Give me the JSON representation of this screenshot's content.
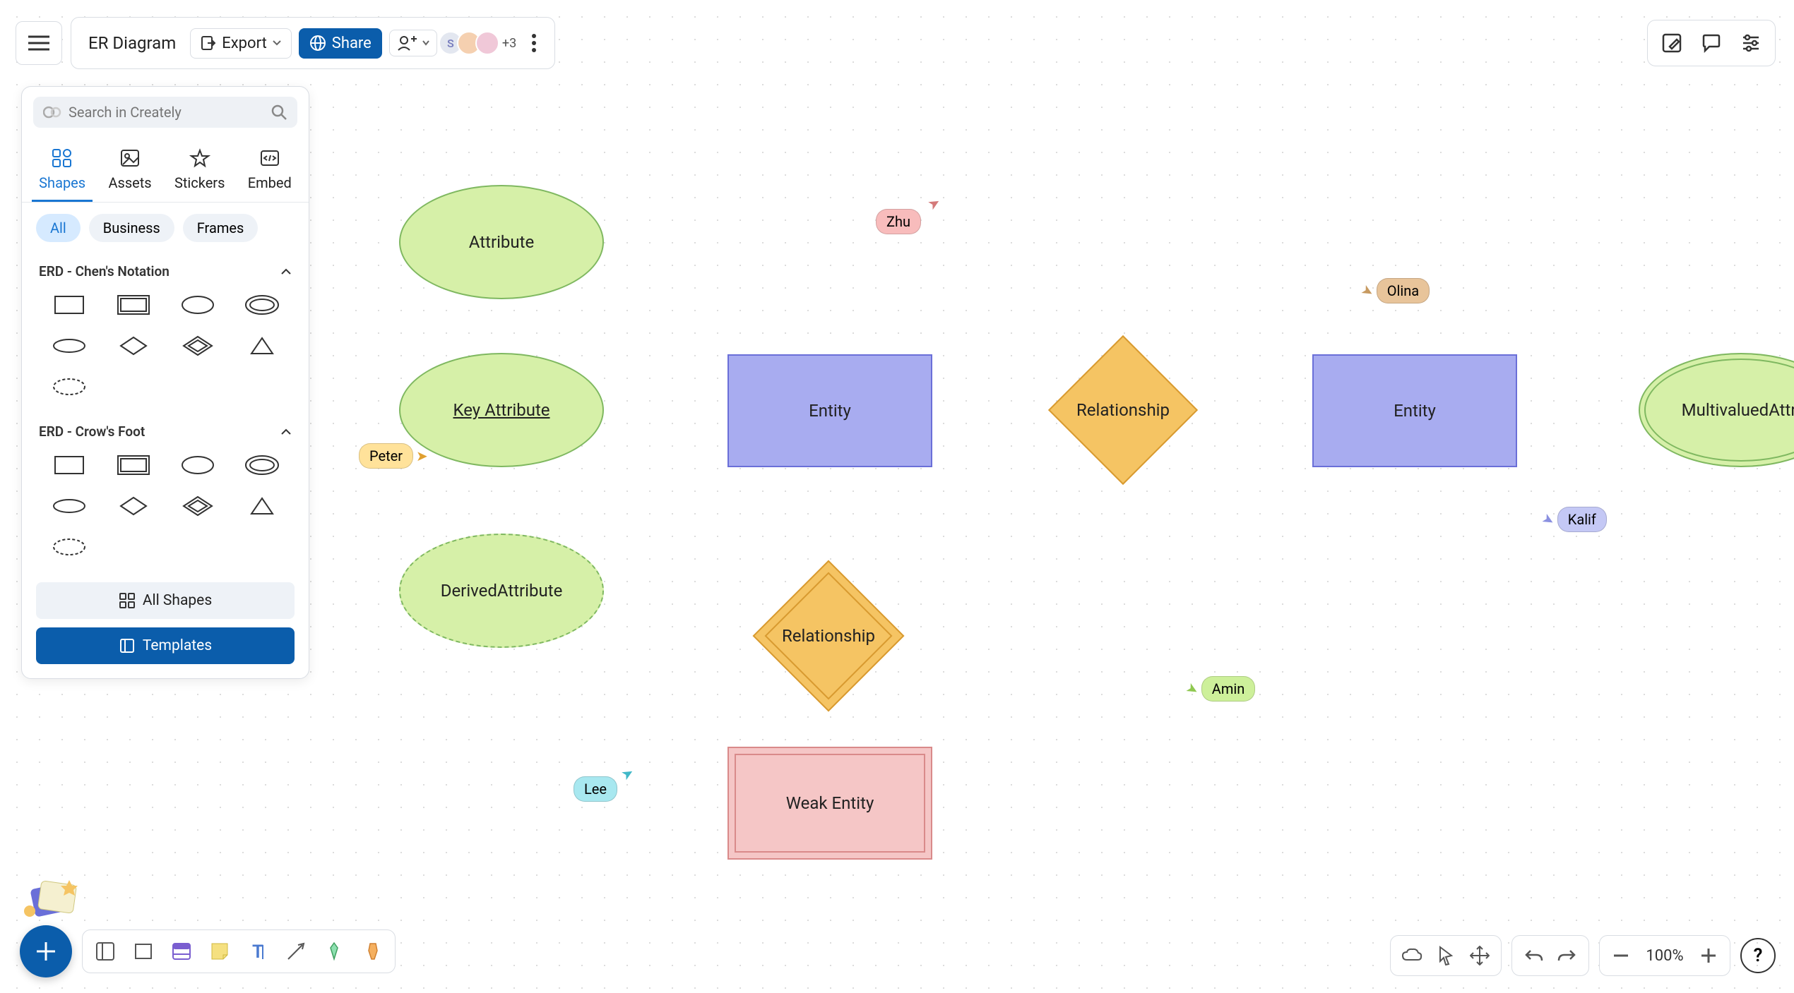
{
  "doc_title": "ER Diagram",
  "toolbar": {
    "export_label": "Export",
    "share_label": "Share",
    "avatar_letter": "S",
    "more_collaborators": "+3"
  },
  "search": {
    "placeholder": "Search in Creately"
  },
  "tabs": {
    "shapes": "Shapes",
    "assets": "Assets",
    "stickers": "Stickers",
    "embed": "Embed"
  },
  "filters": {
    "all": "All",
    "business": "Business",
    "frames": "Frames"
  },
  "sections": {
    "chen": "ERD - Chen's Notation",
    "crow": "ERD - Crow's Foot"
  },
  "panel_footer": {
    "all_shapes": "All Shapes",
    "templates": "Templates"
  },
  "zoom": "100%",
  "shapes": {
    "attribute": "Attribute",
    "key_attribute": "Key Attribute",
    "derived_attribute": "DerivedAttribute",
    "entity1": "Entity",
    "entity2": "Entity",
    "relationship1": "Relationship",
    "relationship2": "Relationship",
    "weak_entity": "Weak Entity",
    "multivalued": "MultivaluedAttri"
  },
  "collaborators": {
    "peter": "Peter",
    "zhu": "Zhu",
    "olina": "Olina",
    "kalif": "Kalif",
    "amin": "Amin",
    "lee": "Lee"
  },
  "help_label": "?"
}
